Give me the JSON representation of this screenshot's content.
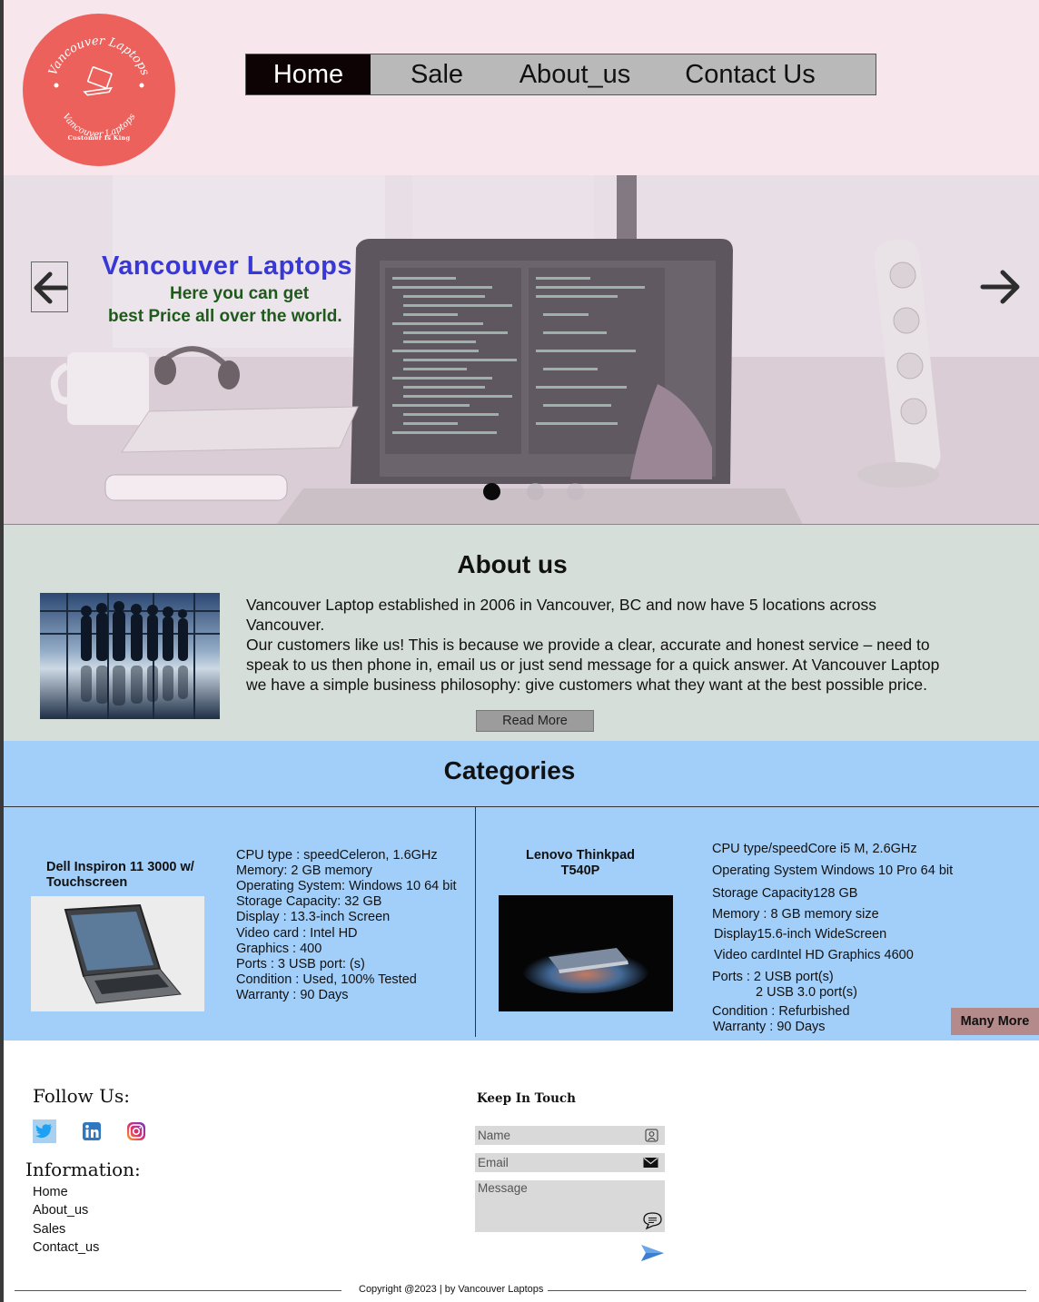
{
  "header": {
    "logo": {
      "name_text": "Vancouver Laptops",
      "tagline": "Customer Is King"
    },
    "nav": [
      {
        "label": "Home",
        "active": true
      },
      {
        "label": "Sale",
        "active": false
      },
      {
        "label": "About_us",
        "active": false
      },
      {
        "label": "Contact Us",
        "active": false
      }
    ]
  },
  "hero": {
    "title": "Vancouver Laptops",
    "subtitle_line1": "Here you can get",
    "subtitle_line2": "best Price all over the world.",
    "slides_count": 3,
    "active_slide": 1
  },
  "about": {
    "title": "About us",
    "text_line1": "Vancouver Laptop established in 2006 in Vancouver, BC and now have 5 locations across Vancouver.",
    "text_line2": "Our customers like us! This is because we provide a clear, accurate and honest service – need to speak to us then phone in, email us or just send message for a quick answer. At Vancouver Laptop we have a simple business philosophy: give customers what they want at the best possible price.",
    "read_more": "Read More"
  },
  "categories": {
    "title": "Categories",
    "products": [
      {
        "name": "Dell Inspiron 11 3000 w/ Touchscreen",
        "specs": [
          "CPU type : speedCeleron, 1.6GHz",
          "Memory: 2 GB memory",
          "Operating System: Windows 10 64 bit",
          "Storage Capacity: 32 GB",
          "Display : 13.3-inch Screen",
          "Video card : Intel HD",
          "Graphics : 400",
          "Ports : 3 USB port: (s)",
          "Condition : Used, 100% Tested",
          "Warranty : 90 Days"
        ]
      },
      {
        "name": "Lenovo Thinkpad T540P",
        "specs": [
          "CPU type/speedCore i5 M, 2.6GHz",
          "Operating System Windows 10 Pro 64 bit",
          "Storage Capacity128 GB",
          "Memory : 8 GB memory size",
          "Display15.6-inch WideScreen",
          "Video cardIntel HD Graphics 4600",
          "Ports : 2 USB port(s)",
          "2 USB 3.0 port(s)",
          "Condition : Refurbished",
          "Warranty : 90 Days"
        ]
      }
    ],
    "many_more": "Many More"
  },
  "footer": {
    "follow_title": "Follow Us:",
    "social": [
      "twitter-icon",
      "linkedin-icon",
      "instagram-icon"
    ],
    "info_title": "Information:",
    "info_links": [
      "Home",
      "About_us",
      "Sales",
      "Contact_us"
    ],
    "keep_in_touch": "Keep In Touch",
    "name_placeholder": "Name",
    "email_placeholder": "Email",
    "message_placeholder": "Message",
    "copyright": "Copyright @2023 | by Vancouver Laptops"
  }
}
